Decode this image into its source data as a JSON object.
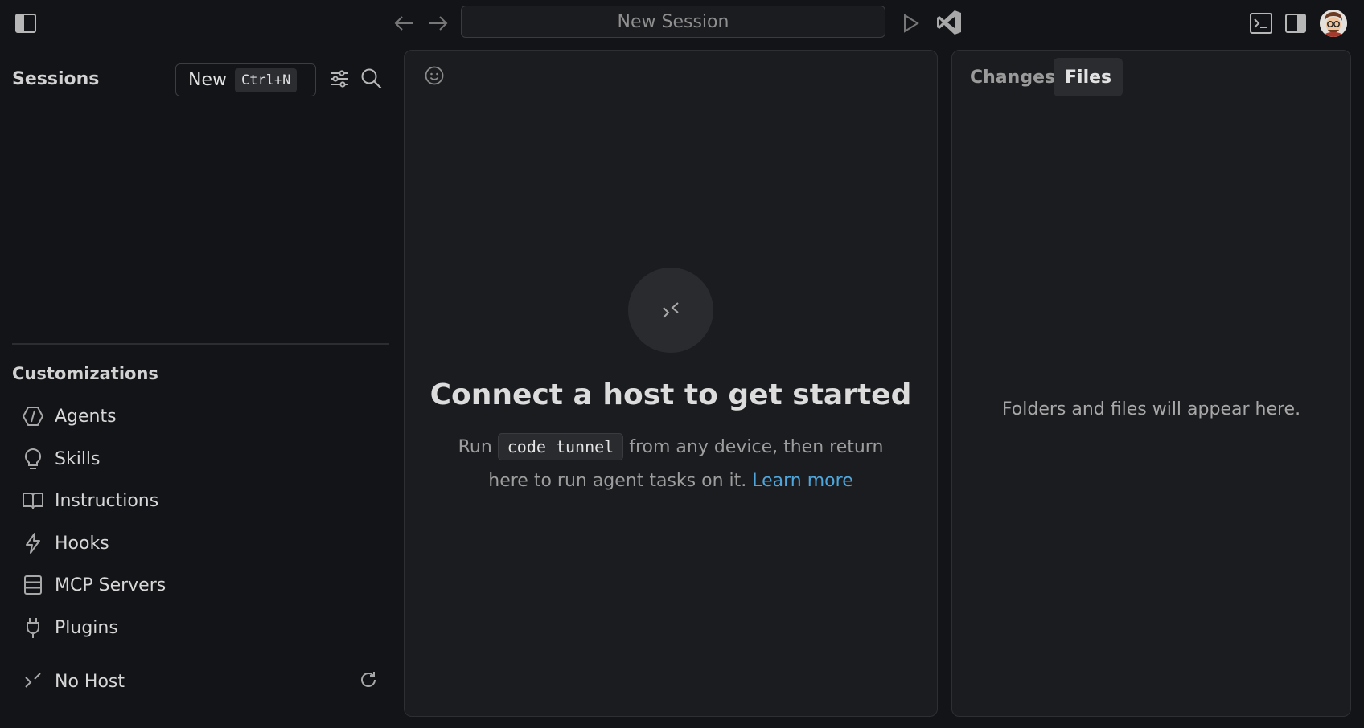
{
  "titlebar": {
    "session_title": "New Session"
  },
  "sidebar": {
    "sessions_title": "Sessions",
    "new_button_label": "New",
    "new_button_shortcut": "Ctrl+N",
    "customizations_title": "Customizations",
    "items": [
      {
        "label": "Agents",
        "icon": "agents-icon"
      },
      {
        "label": "Skills",
        "icon": "lightbulb-icon"
      },
      {
        "label": "Instructions",
        "icon": "book-icon"
      },
      {
        "label": "Hooks",
        "icon": "lightning-icon"
      },
      {
        "label": "MCP Servers",
        "icon": "server-icon"
      },
      {
        "label": "Plugins",
        "icon": "plug-icon"
      }
    ],
    "host_label": "No Host"
  },
  "center": {
    "title": "Connect a host to get started",
    "desc_run": "Run",
    "desc_code": "code tunnel",
    "desc_rest": "from any device, then return here to run agent tasks on it.",
    "learn_more": "Learn more"
  },
  "right_panel": {
    "tabs": [
      {
        "label": "Changes",
        "active": false
      },
      {
        "label": "Files",
        "active": true
      }
    ],
    "empty_text": "Folders and files will appear here."
  },
  "colors": {
    "background": "#131417",
    "panel": "#1b1c1f",
    "link": "#4ea6dc"
  }
}
